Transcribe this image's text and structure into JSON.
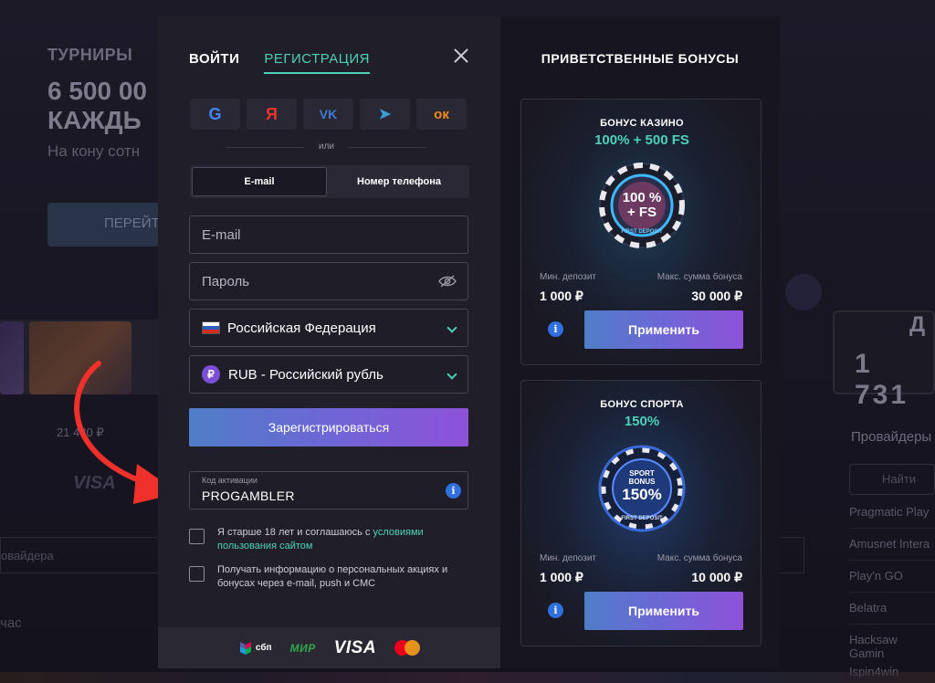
{
  "background": {
    "tournaments_title": "ТУРНИРЫ",
    "headline": "6 500 00\nКАЖДЬ",
    "subtext": "На кону сотн",
    "cta": "ПЕРЕЙТ",
    "game_price": "21 480 ₽",
    "visa": "VISA",
    "providers_input": "овайдера",
    "hour": "час",
    "counter_value": "1 731",
    "counter_letter": "Д",
    "providers_title": "Провайдеры",
    "search_placeholder": "Найти",
    "providers": [
      "Pragmatic Play",
      "Amusnet Intera",
      "Play'n GO",
      "Belatra",
      "Hacksaw Gamin",
      "Ispin4win"
    ]
  },
  "modal": {
    "tabs": [
      {
        "label": "ВОЙТИ",
        "active": false
      },
      {
        "label": "РЕГИСТРАЦИЯ",
        "active": true
      }
    ],
    "social": [
      {
        "icon": "google-icon",
        "glyph": "G",
        "color": "#4285f4"
      },
      {
        "icon": "yandex-icon",
        "glyph": "Я",
        "color": "#e8352b"
      },
      {
        "icon": "vk-icon",
        "glyph": "VK",
        "color": "#3d7bd0"
      },
      {
        "icon": "telegram-icon",
        "glyph": "➤",
        "color": "#3a9ed8"
      },
      {
        "icon": "odnoklassniki-icon",
        "glyph": "ок",
        "color": "#f28b1c"
      }
    ],
    "or_text": "или",
    "method_tabs": {
      "email": "E-mail",
      "phone": "Номер телефона"
    },
    "email_placeholder": "E-mail",
    "password_placeholder": "Пароль",
    "country": "Российская Федерация",
    "currency": "RUB - Российский рубль",
    "currency_symbol": "₽",
    "register_button": "Зарегистрироваться",
    "activation_code": {
      "label": "Код активации",
      "value": "PROGAMBLER"
    },
    "terms_text": "Я старше 18 лет и соглашаюсь с ",
    "terms_link": "условиями пользования сайтом",
    "promo_text": "Получать информацию о персональных акциях и бонусах через e-mail, push и СМС",
    "payments": {
      "sbp": "сбп",
      "mir": "МИР",
      "visa": "VISA"
    }
  },
  "bonuses": {
    "title": "ПРИВЕТСТВЕННЫЕ БОНУСЫ",
    "items": [
      {
        "name": "БОНУС КАЗИНО",
        "amount": "100% + 500 FS",
        "chip_text_1": "100 %",
        "chip_text_2": "+ FS",
        "chip_ring": "FIRST DEPOSIT",
        "min_deposit_label": "Мин. депозит",
        "min_deposit": "1 000 ₽",
        "max_bonus_label": "Макс. сумма бонуса",
        "max_bonus": "30 000 ₽",
        "button": "Применить"
      },
      {
        "name": "БОНУС СПОРТА",
        "amount": "150%",
        "chip_text_1": "SPORT",
        "chip_text_2": "BONUS",
        "chip_text_3": "150%",
        "chip_ring": "FIRST DEPOSIT",
        "min_deposit_label": "Мин. депозит",
        "min_deposit": "1 000 ₽",
        "max_bonus_label": "Макс. сумма бонуса",
        "max_bonus": "10 000 ₽",
        "button": "Применить"
      }
    ]
  },
  "colors": {
    "accent": "#4fd1b9",
    "arrow": "#f0302a",
    "button_start": "#4f7ec7",
    "button_end": "#8e52d8"
  }
}
